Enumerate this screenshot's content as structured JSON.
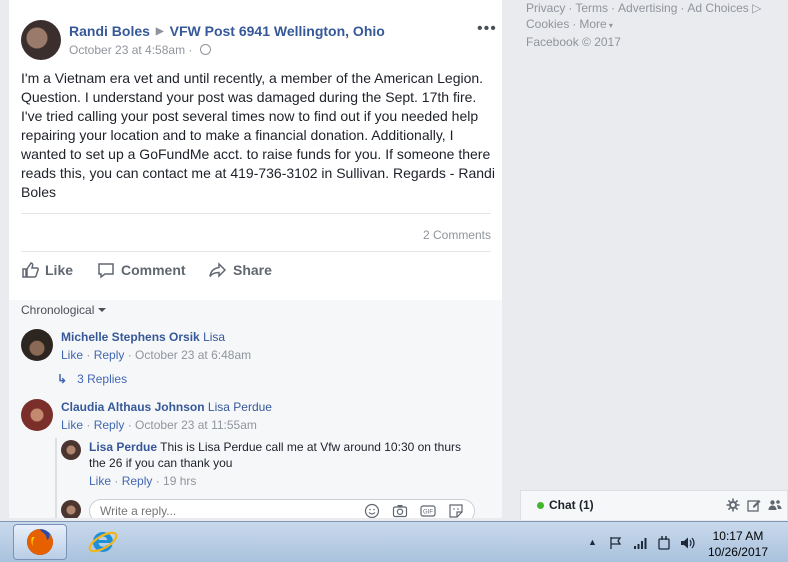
{
  "post": {
    "author": "Randi Boles",
    "target_page": "VFW Post 6941 Wellington, Ohio",
    "timestamp": "October 23 at 4:58am",
    "privacy_icon": "globe-icon",
    "body": "I'm a Vietnam era vet and until recently, a member of the American Legion. Question. I understand your post was damaged during the Sept. 17th fire. I've tried calling your post several times now to find out if you needed help repairing your location and to make a financial donation. Additionally, I wanted to set up a GoFundMe acct. to raise funds for you. If someone there reads this, you can contact me at 419-736-3102 in Sullivan. Regards - Randi Boles",
    "comments_count": "2 Comments",
    "more_label": "•••",
    "actions": {
      "like": "Like",
      "comment": "Comment",
      "share": "Share"
    }
  },
  "comments": {
    "sort_label": "Chronological",
    "items": [
      {
        "author": "Michelle Stephens Orsik",
        "text": "Lisa",
        "like": "Like",
        "reply": "Reply",
        "time": "October 23 at 6:48am",
        "replies_label": "3 Replies"
      },
      {
        "author": "Claudia Althaus Johnson",
        "text": "Lisa Perdue",
        "like": "Like",
        "reply": "Reply",
        "time": "October 23 at 11:55am",
        "reply_item": {
          "author": "Lisa Perdue",
          "text_line1": "This is Lisa Perdue call me at Vfw around 10:30 on thurs",
          "text_line2": "the 26 if you can thank you",
          "like": "Like",
          "reply": "Reply",
          "time": "19 hrs"
        }
      }
    ],
    "reply_placeholder": "Write a reply..."
  },
  "right_column": {
    "links_row1": [
      "Privacy",
      "Terms",
      "Advertising",
      "Ad Choices"
    ],
    "links_row2": [
      "Cookies",
      "More"
    ],
    "copyright": "Facebook © 2017"
  },
  "chat": {
    "label": "Chat (1)",
    "status_color": "#42b72a"
  },
  "taskbar": {
    "time": "10:17 AM",
    "date": "10/26/2017",
    "apps": [
      "firefox-icon",
      "internet-explorer-icon"
    ]
  },
  "colors": {
    "link": "#365899",
    "muted": "#90949c",
    "background": "#e9ebee"
  }
}
